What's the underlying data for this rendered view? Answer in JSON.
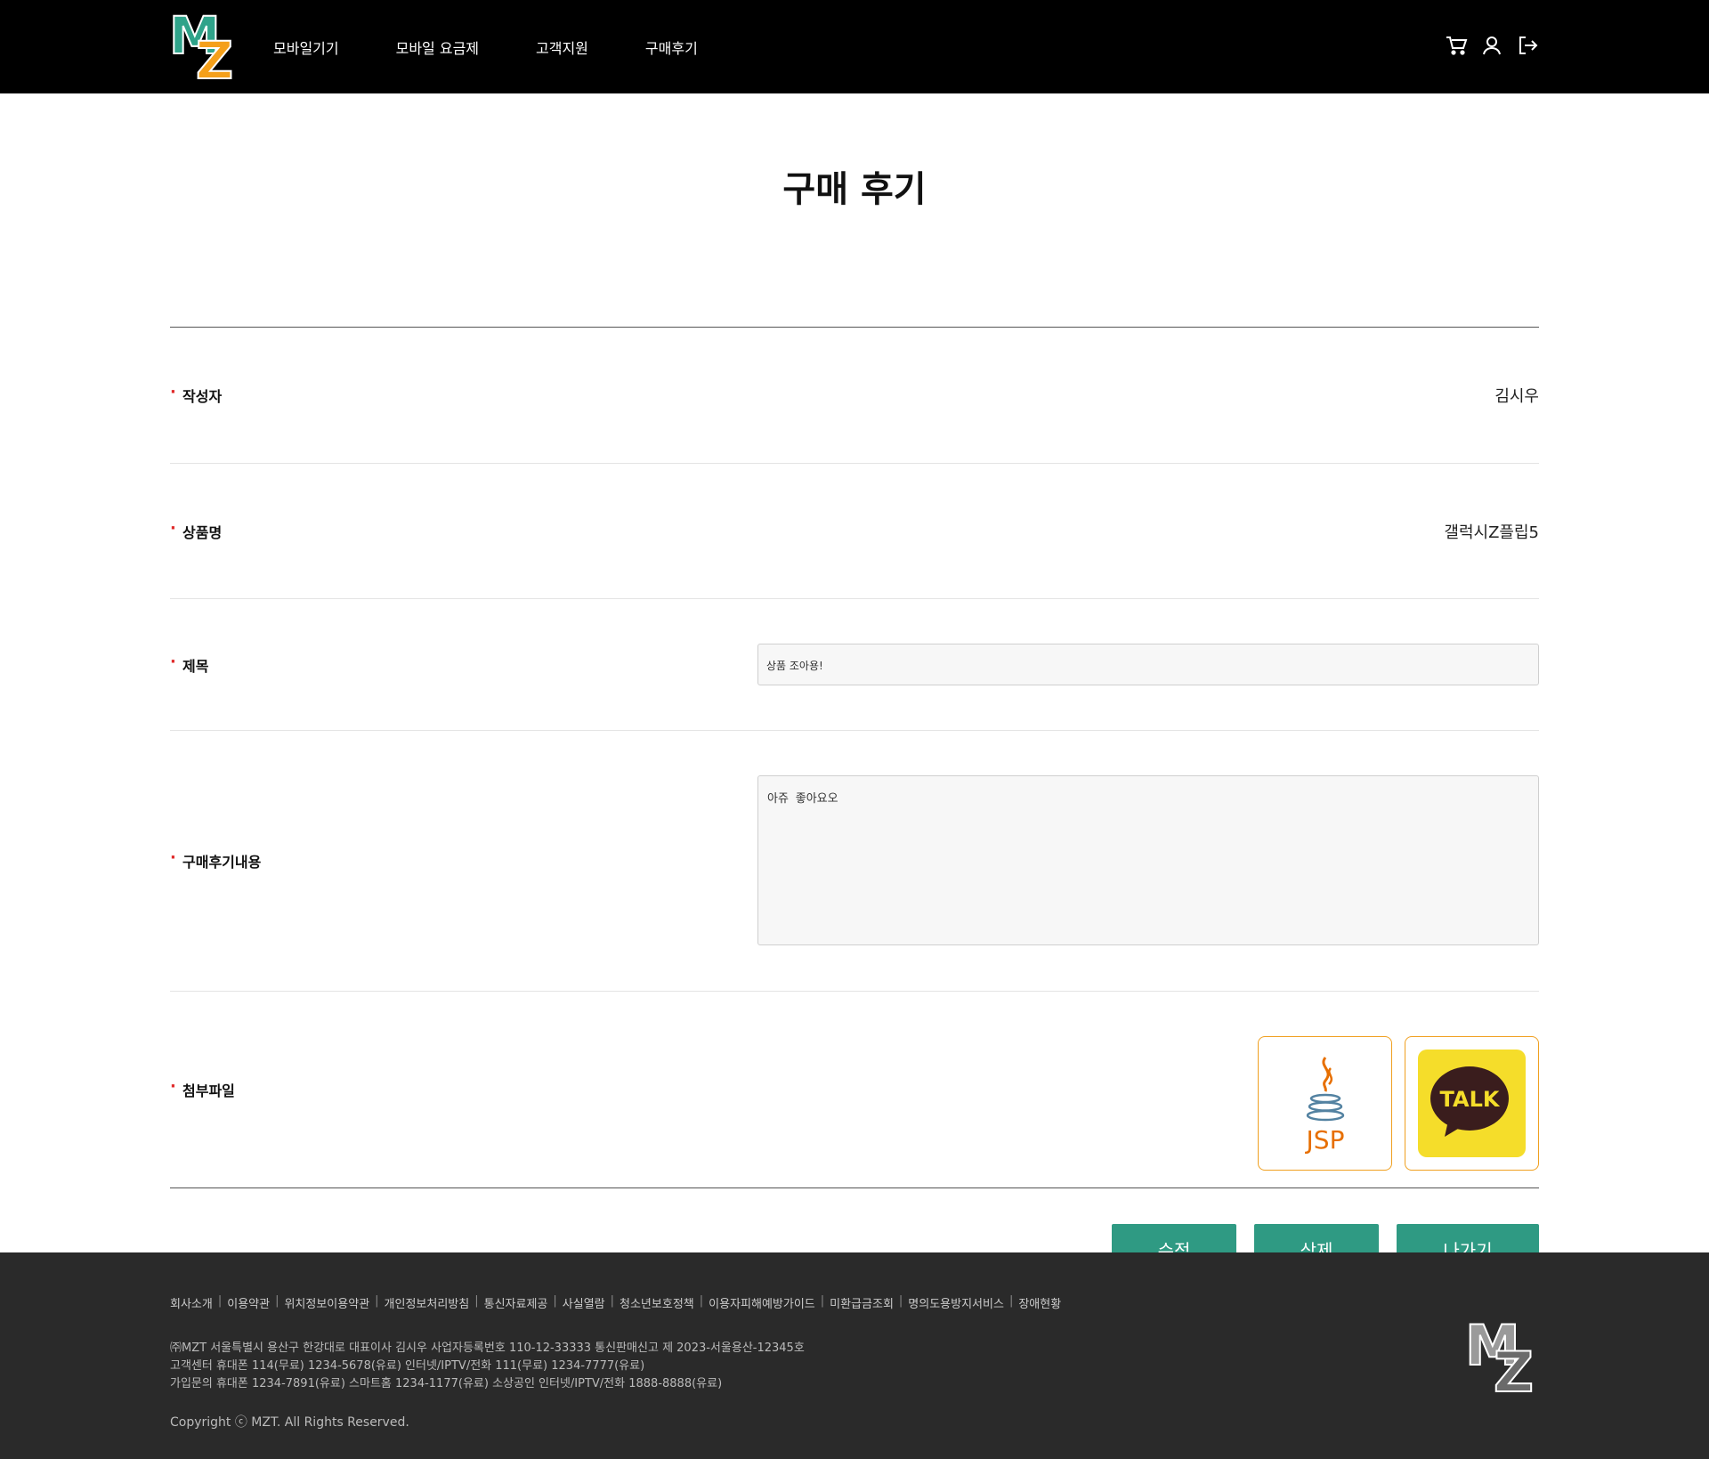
{
  "header": {
    "logo_text": "MZ",
    "nav": [
      "모바일기기",
      "모바일 요금제",
      "고객지원",
      "구매후기"
    ],
    "icons": [
      "cart-icon",
      "user-icon",
      "logout-icon"
    ]
  },
  "page": {
    "title": "구매 후기",
    "fields": {
      "author_label": "작성자",
      "author_value": "김시우",
      "product_label": "상품명",
      "product_value": "갤럭시Z플립5",
      "title_label": "제목",
      "title_value": "상품 조아용!",
      "content_label": "구매후기내용",
      "content_value": "아쥬 좋아요오",
      "files_label": "첨부파일"
    },
    "attachments": [
      {
        "name": "jsp-logo",
        "text": "JSP"
      },
      {
        "name": "kakaotalk-logo",
        "text": "TALK"
      }
    ],
    "buttons": {
      "edit": "수정",
      "delete": "삭제",
      "exit": "나가기"
    }
  },
  "footer": {
    "links": [
      "회사소개",
      "이용약관",
      "위치정보이용약관",
      "개인정보처리방침",
      "통신자료제공",
      "사실열람",
      "청소년보호정책",
      "이용자피해예방가이드",
      "미환급금조회",
      "명의도용방지서비스",
      "장애현황"
    ],
    "info_line1": "㈜MZT 서울특별시 용산구 한강대로 대표이사 김시우 사업자등록번호 110-12-33333 통신판매신고 제 2023-서울용산-12345호",
    "info_line2": "고객센터 휴대폰 114(무료) 1234-5678(유료) 인터넷/IPTV/전화 111(무료) 1234-7777(유료)",
    "info_line3": "가입문의 휴대폰 1234-7891(유료) 스마트홈 1234-1177(유료) 소상공인 인터넷/IPTV/전화 1888-8888(유료)",
    "copyright": "Copyright ⓒ MZT. All Rights Reserved."
  },
  "colors": {
    "header_bg": "#000000",
    "accent_green": "#2f9a83",
    "logo_orange": "#f5a01a",
    "logo_green": "#2fa38a",
    "footer_bg": "#2a2a2a",
    "required_dot": "#e02b2b"
  }
}
